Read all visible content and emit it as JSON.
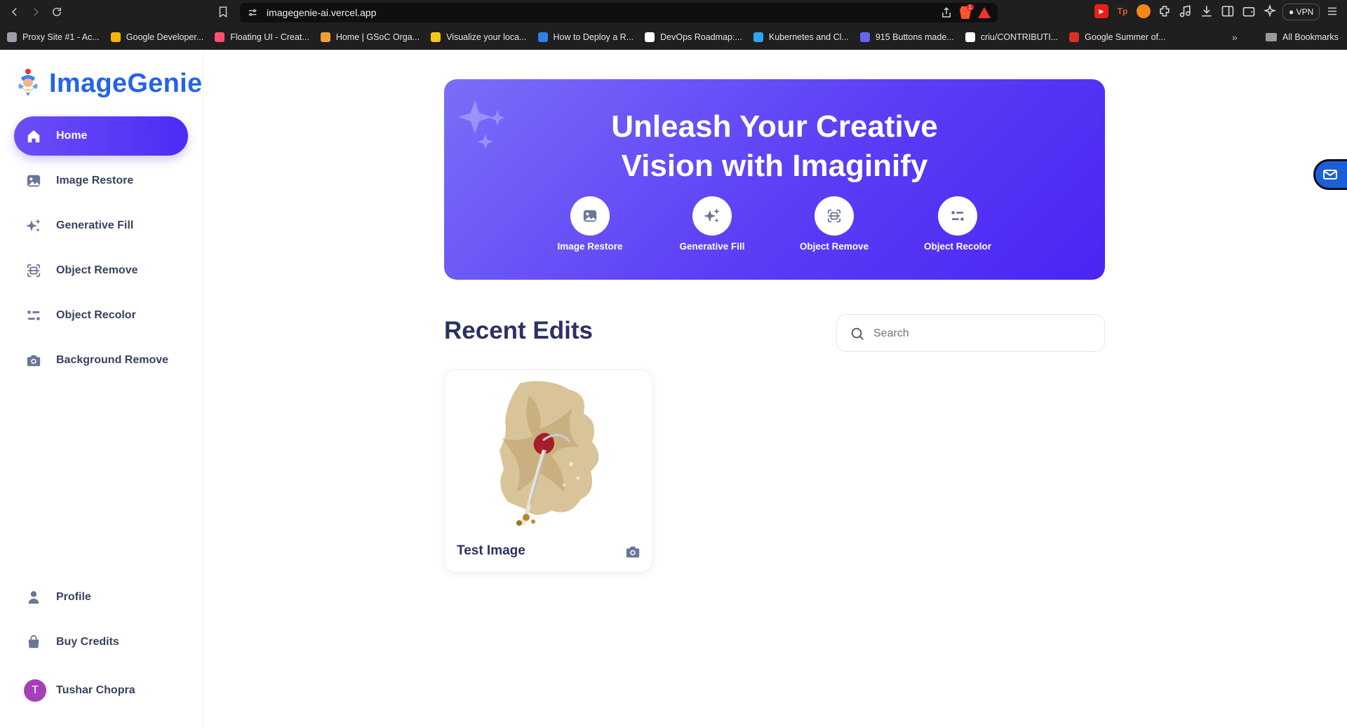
{
  "browser": {
    "url": "imagegenie-ai.vercel.app",
    "vpn_label": "VPN",
    "shield_count": "1",
    "bookmarks": [
      {
        "label": "Proxy Site #1 - Ac...",
        "color": "#9aa0a6"
      },
      {
        "label": "Google Developer...",
        "color": "#f6b400"
      },
      {
        "label": "Floating UI - Creat...",
        "color": "#ff4f6d"
      },
      {
        "label": "Home | GSoC Orga...",
        "color": "#f29d38"
      },
      {
        "label": "Visualize your loca...",
        "color": "#f5c518"
      },
      {
        "label": "How to Deploy a R...",
        "color": "#2f80ed"
      },
      {
        "label": "DevOps Roadmap:...",
        "color": "#ffffff"
      },
      {
        "label": "Kubernetes and Cl...",
        "color": "#2ea3f2"
      },
      {
        "label": "915 Buttons made...",
        "color": "#6366f1"
      },
      {
        "label": "criu/CONTRIBUTI...",
        "color": "#ffffff"
      },
      {
        "label": "Google Summer of...",
        "color": "#d93025"
      }
    ],
    "all_bookmarks_label": "All Bookmarks"
  },
  "sidebar": {
    "logo_text": "ImageGenie",
    "nav": [
      {
        "label": "Home",
        "icon": "home-icon",
        "active": true
      },
      {
        "label": "Image Restore",
        "icon": "image-icon",
        "active": false
      },
      {
        "label": "Generative Fill",
        "icon": "sparkles-icon",
        "active": false
      },
      {
        "label": "Object Remove",
        "icon": "scan-icon",
        "active": false
      },
      {
        "label": "Object Recolor",
        "icon": "filter-icon",
        "active": false
      },
      {
        "label": "Background Remove",
        "icon": "camera-icon",
        "active": false
      }
    ],
    "bottom": [
      {
        "label": "Profile",
        "icon": "user-icon"
      },
      {
        "label": "Buy Credits",
        "icon": "bag-icon"
      }
    ],
    "user": {
      "name": "Tushar Chopra",
      "initial": "T"
    }
  },
  "hero": {
    "title_line1": "Unleash Your Creative",
    "title_line2": "Vision with Imaginify",
    "actions": [
      {
        "label": "Image Restore",
        "icon": "image-icon"
      },
      {
        "label": "Generative Fill",
        "icon": "sparkles-icon"
      },
      {
        "label": "Object Remove",
        "icon": "scan-icon"
      },
      {
        "label": "Object Recolor",
        "icon": "filter-icon"
      }
    ]
  },
  "recent": {
    "title": "Recent Edits",
    "search_placeholder": "Search",
    "items": [
      {
        "title": "Test Image",
        "type_icon": "camera-icon"
      }
    ]
  },
  "colors": {
    "brand": "#2563eb",
    "accent": "#5a3ef6",
    "heading": "#2a3163"
  }
}
